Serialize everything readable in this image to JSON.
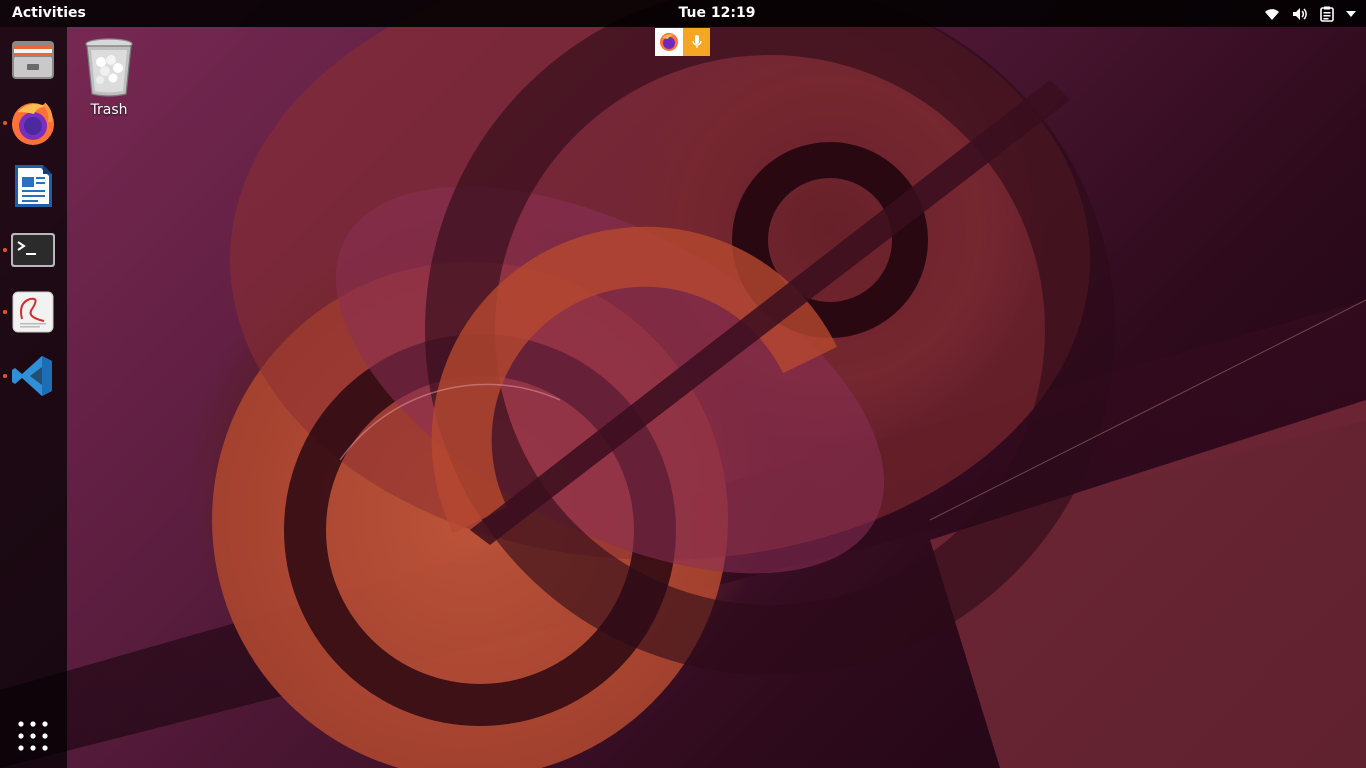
{
  "topbar": {
    "activities": "Activities",
    "clock": "Tue 12:19",
    "tray_icons": [
      "wifi-icon",
      "volume-icon",
      "clipboard-icon",
      "menu-arrow-icon"
    ]
  },
  "sharing_indicator": {
    "icons": [
      "firefox-icon",
      "microphone-icon"
    ],
    "mic_color": "#f5a623"
  },
  "dock": {
    "apps": [
      {
        "name": "files",
        "icon": "file-cabinet-icon",
        "running": false
      },
      {
        "name": "firefox",
        "icon": "firefox-icon",
        "running": true
      },
      {
        "name": "libreoffice-writer",
        "icon": "document-icon",
        "running": false
      },
      {
        "name": "terminal",
        "icon": "terminal-icon",
        "running": true
      },
      {
        "name": "document-viewer",
        "icon": "pdf-viewer-icon",
        "running": true
      },
      {
        "name": "vscode",
        "icon": "vscode-icon",
        "running": true
      }
    ],
    "show_apps_icon": "app-grid-icon",
    "running_dot_color": "#e95420"
  },
  "desktop": {
    "icons": [
      {
        "label": "Trash",
        "icon": "trash-icon"
      }
    ]
  },
  "colors": {
    "topbar_bg": "#000000",
    "accent": "#e95420",
    "vscode_blue": "#2f8fd8"
  }
}
